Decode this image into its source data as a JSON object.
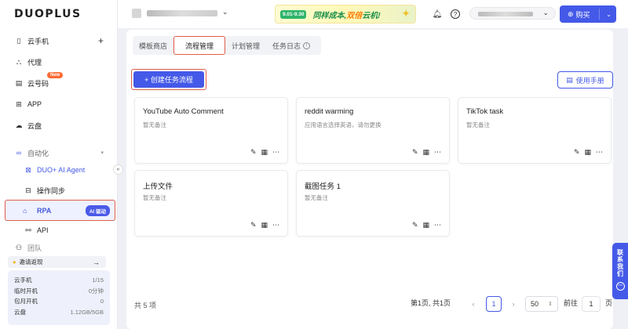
{
  "app": {
    "logo": "DUOPLUS"
  },
  "sidebar": {
    "items": [
      {
        "label": "云手机",
        "icon": "phone-icon",
        "plus": "+"
      },
      {
        "label": "代理",
        "icon": "proxy-icon"
      },
      {
        "label": "云号码",
        "icon": "sim-icon",
        "badge": "New"
      },
      {
        "label": "APP",
        "icon": "apps-icon"
      },
      {
        "label": "云盘",
        "icon": "cloud-icon"
      }
    ],
    "automation": {
      "label": "自动化",
      "icon": "infinity-icon"
    },
    "sub_items": [
      {
        "label": "DUO+ AI Agent",
        "icon": "ai-agent-icon"
      },
      {
        "label": "操作同步",
        "icon": "sync-icon"
      },
      {
        "label": "RPA",
        "icon": "robot-icon",
        "badge": "AI 驱动"
      },
      {
        "label": "API",
        "icon": "api-icon"
      }
    ],
    "partial_item": "团队",
    "collapse": "«",
    "invite": {
      "label": "邀请返现",
      "arrow": "→"
    },
    "stats": [
      {
        "label": "云手机",
        "value": "1/15"
      },
      {
        "label": "临时开机",
        "value": "0分钟"
      },
      {
        "label": "包月开机",
        "value": "0"
      },
      {
        "label": "云盘",
        "value": "1.12GB/5GB"
      }
    ]
  },
  "topbar": {
    "promo": {
      "date": "9.01-9.30",
      "date_sub": "(UTC+8)",
      "text_prefix": "同样成本,",
      "text_highlight": "双倍",
      "text_suffix": "云机!"
    },
    "buy_label": "购买"
  },
  "tabs": [
    "模板商店",
    "流程管理",
    "计划管理",
    "任务日志"
  ],
  "active_tab": "流程管理",
  "toolbar": {
    "create_label": "+ 创建任务流程",
    "manual_label": "使用手册"
  },
  "cards": [
    {
      "title": "YouTube Auto Comment",
      "desc": "暂无备注"
    },
    {
      "title": "reddit warming",
      "desc": "应用语言选择英语，请勿更换"
    },
    {
      "title": "TikTok task",
      "desc": "暂无备注"
    },
    {
      "title": "上传文件",
      "desc": "暂无备注"
    },
    {
      "title": "截图任务 1",
      "desc": "暂无备注"
    }
  ],
  "pagination": {
    "total": "共 5 项",
    "page_info": "第1页, 共1页",
    "current": "1",
    "page_size": "50",
    "goto_prefix": "前往",
    "goto_value": "1",
    "goto_suffix": "页"
  },
  "contact": "联系我们"
}
